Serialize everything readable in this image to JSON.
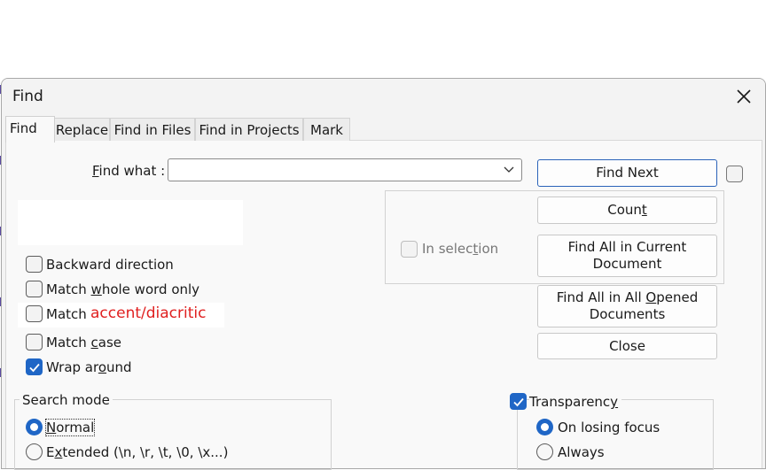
{
  "dialog": {
    "title": "Find"
  },
  "tabs": [
    {
      "label": "Find"
    },
    {
      "label": "Replace"
    },
    {
      "label": "Find in Files"
    },
    {
      "label": "Find in Projects"
    },
    {
      "label": "Mark"
    }
  ],
  "find_what": {
    "label_prefix": "",
    "label_accel": "F",
    "label_rest": "ind what :",
    "value": ""
  },
  "buttons": {
    "find_next": "Find Next",
    "count_pre": "Coun",
    "count_accel": "t",
    "count_post": "",
    "find_all_current_l1": "Find All in Current",
    "find_all_current_l2": "Document",
    "find_all_opened_l1_pre": "Find All in All ",
    "find_all_opened_l1_accel": "O",
    "find_all_opened_l1_post": "pened",
    "find_all_opened_l2": "Documents",
    "close": "Close"
  },
  "in_selection": {
    "pre": "In selec",
    "accel": "t",
    "post": "ion",
    "checked": false
  },
  "options": {
    "backward": {
      "pre": "Backward direction",
      "accel": "",
      "post": "",
      "checked": false
    },
    "whole_word": {
      "pre": "Match ",
      "accel": "w",
      "post": "hole word only",
      "checked": false
    },
    "accent_prefix": "Match",
    "accent_suffix": "accent/diacritic",
    "match_case": {
      "pre": "Match ",
      "accel": "c",
      "post": "ase",
      "checked": false
    },
    "wrap_around": {
      "pre": "Wrap ar",
      "accel": "o",
      "post": "und",
      "checked": true
    }
  },
  "search_mode": {
    "title": "Search mode",
    "normal": {
      "accel": "N",
      "post": "ormal",
      "checked": true
    },
    "extended": {
      "pre": "E",
      "accel": "x",
      "post": "tended (\\n, \\r, \\t, \\0, \\x...)",
      "checked": false
    }
  },
  "transparency": {
    "pre": "Transparenc",
    "accel": "y",
    "post": "",
    "checked": true,
    "on_losing_focus": "On losing focus",
    "always": "Always",
    "on_losing_focus_checked": true
  },
  "colors": {
    "accent": "#1f66c6",
    "highlight_text": "#e02020"
  }
}
